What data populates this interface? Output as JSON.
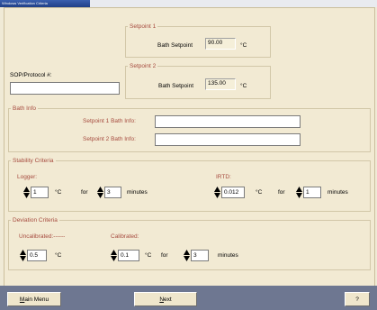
{
  "window": {
    "title": "Windows Verification Criteria"
  },
  "setpoint1": {
    "legend": "Setpoint 1",
    "label": "Bath Setpoint",
    "value": "90.00",
    "unit": "°C"
  },
  "setpoint2": {
    "legend": "Setpoint 2",
    "label": "Bath Setpoint",
    "value": "135.00",
    "unit": "°C"
  },
  "sop": {
    "label": "SOP/Protocol #:",
    "value": ""
  },
  "bath_info": {
    "legend": "Bath Info",
    "sp1_label": "Setpoint 1 Bath Info:",
    "sp1_value": "",
    "sp2_label": "Setpoint 2 Bath Info:",
    "sp2_value": ""
  },
  "stability": {
    "legend": "Stability Criteria",
    "logger_label": "Logger:",
    "logger_temp": "1",
    "logger_temp_unit": "°C",
    "for_label": "for",
    "logger_minutes": "3",
    "minutes_label": "minutes",
    "irtd_label": "IRTD:",
    "irtd_temp": "0.012",
    "irtd_temp_unit": "°C",
    "irtd_for_label": "for",
    "irtd_minutes": "1",
    "irtd_minutes_label": "minutes"
  },
  "deviation": {
    "legend": "Deviation Criteria",
    "uncal_label": "Uncalibrated:------",
    "uncal_value": "0.5",
    "uncal_unit": "°C",
    "cal_label": "Calibrated:",
    "cal_value": "0.1",
    "cal_unit": "°C",
    "cal_for_label": "for",
    "cal_minutes": "3",
    "cal_minutes_label": "minutes"
  },
  "buttons": {
    "main_menu_u": "M",
    "main_menu_rest": "ain Menu",
    "next_u": "N",
    "next_rest": "ext",
    "help": "?"
  }
}
